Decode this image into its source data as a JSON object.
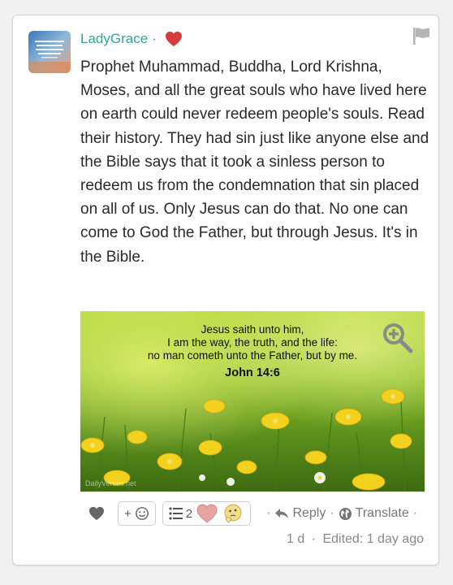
{
  "post": {
    "author": "LadyGrace",
    "author_sep": "·",
    "text": "Prophet Muhammad, Buddha, Lord Krishna, Moses, and all the great souls who have lived here on earth could never redeem people's souls. Read their history. They had sin just like anyone else and the Bible says that it took a sinless person to redeem us from the condemnation that sin placed on all of us. Only Jesus can do that. No one can come to God the Father, but through Jesus. It's in the Bible.",
    "image": {
      "line1": "Jesus saith unto him,",
      "line2": "I am the way, the truth, and the life:",
      "line3": "no man cometh unto the Father, but by me.",
      "reference": "John 14:6",
      "watermark": "DailyVerses.net"
    }
  },
  "actions": {
    "add_reaction_label": "+",
    "reactions_count": "2",
    "dot": "·",
    "reply_label": "Reply",
    "translate_label": "Translate"
  },
  "meta": {
    "time": "1 d",
    "sep": "·",
    "edited": "Edited: 1 day ago"
  },
  "colors": {
    "author": "#2fa59b",
    "heart": "#d63c3c",
    "text": "#2a2a2a",
    "muted": "#777777"
  }
}
